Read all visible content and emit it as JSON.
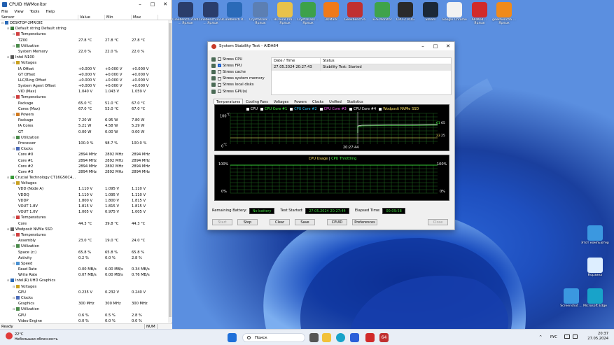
{
  "hwmonitor": {
    "title": "CPUID HWMonitor",
    "menu": [
      "File",
      "View",
      "Tools",
      "Help"
    ],
    "columns": [
      "Sensor",
      "Value",
      "Min",
      "Max"
    ],
    "rows": [
      {
        "n": "DESKTOP-2MRI3IE",
        "l": 0,
        "v": "",
        "mi": "",
        "ma": "",
        "i": "pc"
      },
      {
        "n": "Default string Default string",
        "l": 1,
        "v": "",
        "mi": "",
        "ma": "",
        "i": "board"
      },
      {
        "n": "Temperatures",
        "l": 2,
        "v": "",
        "mi": "",
        "ma": "",
        "i": "temp"
      },
      {
        "n": "TZ00",
        "l": 3,
        "v": "27.8 °C",
        "mi": "27.8 °C",
        "ma": "27.8 °C",
        "i": ""
      },
      {
        "n": "Utilization",
        "l": 2,
        "v": "",
        "mi": "",
        "ma": "",
        "i": "util"
      },
      {
        "n": "System Memory",
        "l": 3,
        "v": "22.0 %",
        "mi": "22.0 %",
        "ma": "22.0 %",
        "i": ""
      },
      {
        "n": "Intel N100",
        "l": 1,
        "v": "",
        "mi": "",
        "ma": "",
        "i": "cpu"
      },
      {
        "n": "Voltages",
        "l": 2,
        "v": "",
        "mi": "",
        "ma": "",
        "i": "volt"
      },
      {
        "n": "IA Offset",
        "l": 3,
        "v": "+0.000 V",
        "mi": "+0.000 V",
        "ma": "+0.000 V",
        "i": ""
      },
      {
        "n": "GT Offset",
        "l": 3,
        "v": "+0.000 V",
        "mi": "+0.000 V",
        "ma": "+0.000 V",
        "i": ""
      },
      {
        "n": "LLC/Ring Offset",
        "l": 3,
        "v": "+0.000 V",
        "mi": "+0.000 V",
        "ma": "+0.000 V",
        "i": ""
      },
      {
        "n": "System Agent Offset",
        "l": 3,
        "v": "+0.000 V",
        "mi": "+0.000 V",
        "ma": "+0.000 V",
        "i": ""
      },
      {
        "n": "VID (Max)",
        "l": 3,
        "v": "1.040 V",
        "mi": "1.043 V",
        "ma": "1.059 V",
        "i": ""
      },
      {
        "n": "Temperatures",
        "l": 2,
        "v": "",
        "mi": "",
        "ma": "",
        "i": "temp"
      },
      {
        "n": "Package",
        "l": 3,
        "v": "65.0 °C",
        "mi": "51.0 °C",
        "ma": "67.0 °C",
        "i": ""
      },
      {
        "n": "Cores (Max)",
        "l": 3,
        "v": "67.0 °C",
        "mi": "53.0 °C",
        "ma": "67.0 °C",
        "i": ""
      },
      {
        "n": "Powers",
        "l": 2,
        "v": "",
        "mi": "",
        "ma": "",
        "i": "power"
      },
      {
        "n": "Package",
        "l": 3,
        "v": "7.20 W",
        "mi": "6.95 W",
        "ma": "7.80 W",
        "i": ""
      },
      {
        "n": "IA Cores",
        "l": 3,
        "v": "5.21 W",
        "mi": "4.58 W",
        "ma": "5.29 W",
        "i": ""
      },
      {
        "n": "GT",
        "l": 3,
        "v": "0.00 W",
        "mi": "0.00 W",
        "ma": "0.00 W",
        "i": ""
      },
      {
        "n": "Utilization",
        "l": 2,
        "v": "",
        "mi": "",
        "ma": "",
        "i": "util"
      },
      {
        "n": "Processor",
        "l": 3,
        "v": "100.0 %",
        "mi": "98.7 %",
        "ma": "100.0 %",
        "i": ""
      },
      {
        "n": "Clocks",
        "l": 2,
        "v": "",
        "mi": "",
        "ma": "",
        "i": "clock"
      },
      {
        "n": "Core #0",
        "l": 3,
        "v": "2894 MHz",
        "mi": "2892 MHz",
        "ma": "2894 MHz",
        "i": ""
      },
      {
        "n": "Core #1",
        "l": 3,
        "v": "2894 MHz",
        "mi": "2892 MHz",
        "ma": "2894 MHz",
        "i": ""
      },
      {
        "n": "Core #2",
        "l": 3,
        "v": "2894 MHz",
        "mi": "2892 MHz",
        "ma": "2894 MHz",
        "i": ""
      },
      {
        "n": "Core #3",
        "l": 3,
        "v": "2894 MHz",
        "mi": "2892 MHz",
        "ma": "2894 MHz",
        "i": ""
      },
      {
        "n": "Crucial Technology CT16G56C4...",
        "l": 1,
        "v": "",
        "mi": "",
        "ma": "",
        "i": "ram"
      },
      {
        "n": "Voltages",
        "l": 2,
        "v": "",
        "mi": "",
        "ma": "",
        "i": "volt"
      },
      {
        "n": "VDD (Node A)",
        "l": 3,
        "v": "1.110 V",
        "mi": "1.095 V",
        "ma": "1.110 V",
        "i": ""
      },
      {
        "n": "VDDQ",
        "l": 3,
        "v": "1.110 V",
        "mi": "1.095 V",
        "ma": "1.110 V",
        "i": ""
      },
      {
        "n": "VDDP",
        "l": 3,
        "v": "1.800 V",
        "mi": "1.800 V",
        "ma": "1.815 V",
        "i": ""
      },
      {
        "n": "VOUT 1.8V",
        "l": 3,
        "v": "1.815 V",
        "mi": "1.815 V",
        "ma": "1.815 V",
        "i": ""
      },
      {
        "n": "VOUT 1.0V",
        "l": 3,
        "v": "1.005 V",
        "mi": "0.975 V",
        "ma": "1.005 V",
        "i": ""
      },
      {
        "n": "Temperatures",
        "l": 2,
        "v": "",
        "mi": "",
        "ma": "",
        "i": "temp"
      },
      {
        "n": "Core",
        "l": 3,
        "v": "44.3 °C",
        "mi": "39.8 °C",
        "ma": "44.3 °C",
        "i": ""
      },
      {
        "n": "Wodposit NVMe SSD",
        "l": 1,
        "v": "",
        "mi": "",
        "ma": "",
        "i": "ssd"
      },
      {
        "n": "Temperatures",
        "l": 2,
        "v": "",
        "mi": "",
        "ma": "",
        "i": "temp"
      },
      {
        "n": "Assembly",
        "l": 3,
        "v": "23.0 °C",
        "mi": "19.0 °C",
        "ma": "24.0 °C",
        "i": ""
      },
      {
        "n": "Utilization",
        "l": 2,
        "v": "",
        "mi": "",
        "ma": "",
        "i": "util"
      },
      {
        "n": "Space (c:)",
        "l": 3,
        "v": "65.8 %",
        "mi": "65.8 %",
        "ma": "65.8 %",
        "i": ""
      },
      {
        "n": "Activity",
        "l": 3,
        "v": "0.2 %",
        "mi": "0.0 %",
        "ma": "2.8 %",
        "i": ""
      },
      {
        "n": "Speed",
        "l": 2,
        "v": "",
        "mi": "",
        "ma": "",
        "i": "speed"
      },
      {
        "n": "Read Rate",
        "l": 3,
        "v": "0.00 MB/s",
        "mi": "0.00 MB/s",
        "ma": "0.34 MB/s",
        "i": ""
      },
      {
        "n": "Write Rate",
        "l": 3,
        "v": "0.07 MB/s",
        "mi": "0.00 MB/s",
        "ma": "0.76 MB/s",
        "i": ""
      },
      {
        "n": "Intel(R) UHD Graphics",
        "l": 1,
        "v": "",
        "mi": "",
        "ma": "",
        "i": "gpu"
      },
      {
        "n": "Voltages",
        "l": 2,
        "v": "",
        "mi": "",
        "ma": "",
        "i": "volt"
      },
      {
        "n": "GPU",
        "l": 3,
        "v": "0.235 V",
        "mi": "0.232 V",
        "ma": "0.240 V",
        "i": ""
      },
      {
        "n": "Clocks",
        "l": 2,
        "v": "",
        "mi": "",
        "ma": "",
        "i": "clock"
      },
      {
        "n": "Graphics",
        "l": 3,
        "v": "300 MHz",
        "mi": "300 MHz",
        "ma": "300 MHz",
        "i": ""
      },
      {
        "n": "Utilization",
        "l": 2,
        "v": "",
        "mi": "",
        "ma": "",
        "i": "util"
      },
      {
        "n": "GPU",
        "l": 3,
        "v": "0.6 %",
        "mi": "0.5 %",
        "ma": "2.8 %",
        "i": ""
      },
      {
        "n": "Video Engine",
        "l": 3,
        "v": "0.0 %",
        "mi": "0.0 %",
        "ma": "0.0 %",
        "i": ""
      }
    ],
    "status": "Ready",
    "num": "NUM"
  },
  "aida": {
    "title": "System Stability Test - AIDA64",
    "stress": [
      {
        "label": "Stress CPU",
        "checked": false
      },
      {
        "label": "Stress FPU",
        "checked": true
      },
      {
        "label": "Stress cache",
        "checked": false
      },
      {
        "label": "Stress system memory",
        "checked": false
      },
      {
        "label": "Stress local disks",
        "checked": false
      },
      {
        "label": "Stress GPU(s)",
        "checked": false
      }
    ],
    "status_header": {
      "a": "Date / Time",
      "b": "Status"
    },
    "status_row": {
      "a": "27.05.2024 20:27:43",
      "b": "Stability Test: Started"
    },
    "tabs": [
      "Temperatures",
      "Cooling Fans",
      "Voltages",
      "Powers",
      "Clocks",
      "Unified",
      "Statistics"
    ],
    "legend": [
      {
        "label": "CPU",
        "color": "#ffffff"
      },
      {
        "label": "CPU Core #1",
        "color": "#44ff44"
      },
      {
        "label": "CPU Core #2",
        "color": "#33ccff"
      },
      {
        "label": "CPU Core #3",
        "color": "#ff66ff"
      },
      {
        "label": "CPU Core #4",
        "color": "#ffffff"
      },
      {
        "label": "Wodposit NVMe SSD",
        "color": "#ffe666"
      }
    ],
    "temp_chart": {
      "y_top": "100",
      "y_top_unit": "°C",
      "y_bottom": "0",
      "y_bottom_unit": "°C",
      "time": "20:27:44",
      "right_vals": [
        "61",
        "65",
        "23",
        "25"
      ]
    },
    "util_chart": {
      "title1": "CPU Usage",
      "sep": "|",
      "title2": "CPU Throttling",
      "y_top": "100%",
      "y_bottom": "0%",
      "right_top": "100%",
      "right_bottom": "0%"
    },
    "remaining_battery_label": "Remaining Battery:",
    "remaining_battery": "No battery",
    "test_started_label": "Test Started:",
    "test_started": "27.05.2024 20:27:44",
    "elapsed_label": "Elapsed Time:",
    "elapsed": "00:09:58",
    "buttons": [
      "Start",
      "Stop",
      "Clear",
      "Save",
      "CPUID",
      "Preferences",
      "Close"
    ]
  },
  "desktop_icons": [
    {
      "label": "Cinebench 2024 ... Ярлык",
      "color": "#2a3d6b"
    },
    {
      "label": "Cinebench R23 ... Ярлык",
      "color": "#2a3d6b"
    },
    {
      "label": "Cinebench R...",
      "color": "#2a6ab8"
    },
    {
      "label": "CrystalDisk ... Ярлык",
      "color": "#5c7fb3"
    },
    {
      "label": "HDTune Pro ... Ярлык",
      "color": "#e8c24a"
    },
    {
      "label": "CrystalDisk ... Ярлык",
      "color": "#3da14a"
    },
    {
      "label": "3DMark",
      "color": "#f07a1a"
    },
    {
      "label": "Geekbench 6",
      "color": "#c03030"
    },
    {
      "label": "FPS Monitor",
      "color": "#3fa34a"
    },
    {
      "label": "CPU-Z ROG",
      "color": "#2a2a2a"
    },
    {
      "label": "Steam",
      "color": "#1b2838"
    },
    {
      "label": "Google Chrome",
      "color": "#f2f2f2"
    },
    {
      "label": "AIDA64 ... Ярлык",
      "color": "#d12a2a"
    },
    {
      "label": "geekbench6 ... Ярлык",
      "color": "#f08a1a"
    }
  ],
  "right_icons": [
    {
      "label": "Этот компьютер",
      "color": "#3b98e0"
    },
    {
      "label": "Корзина",
      "color": "#ddeeff"
    },
    {
      "label": "Screenshot ...",
      "color": "#3b98e0"
    },
    {
      "label": "Microsoft Edge",
      "color": "#18a3c9"
    }
  ],
  "taskbar": {
    "temp": "22°C",
    "weather": "Небольшая облачность",
    "search": "Поиск",
    "lang": "РУС",
    "time": "20:37",
    "date": "27.05.2024"
  }
}
